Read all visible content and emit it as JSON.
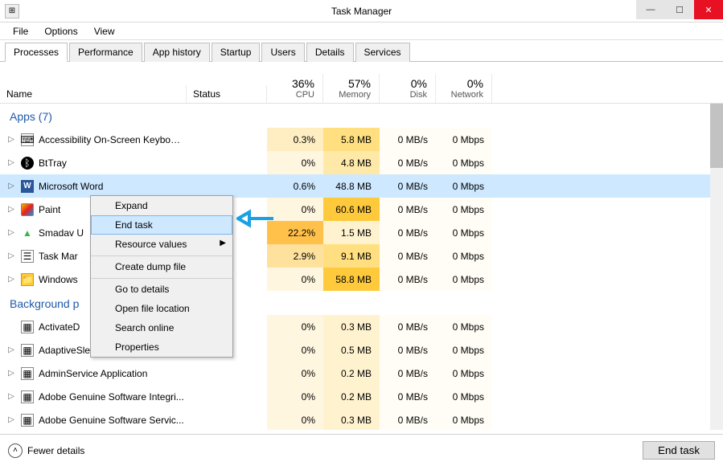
{
  "window": {
    "title": "Task Manager",
    "menus": [
      "File",
      "Options",
      "View"
    ],
    "tabs": [
      "Processes",
      "Performance",
      "App history",
      "Startup",
      "Users",
      "Details",
      "Services"
    ],
    "active_tab": 0
  },
  "columns": {
    "name": "Name",
    "status": "Status",
    "cpu": {
      "pct": "36%",
      "label": "CPU"
    },
    "memory": {
      "pct": "57%",
      "label": "Memory"
    },
    "disk": {
      "pct": "0%",
      "label": "Disk"
    },
    "network": {
      "pct": "0%",
      "label": "Network"
    }
  },
  "groups": {
    "apps_header": "Apps (7)",
    "background_header": "Background p"
  },
  "apps": [
    {
      "name": "Accessibility On-Screen Keyboard",
      "cpu": "0.3%",
      "mem": "5.8 MB",
      "disk": "0 MB/s",
      "net": "0 Mbps"
    },
    {
      "name": "BtTray",
      "cpu": "0%",
      "mem": "4.8 MB",
      "disk": "0 MB/s",
      "net": "0 Mbps"
    },
    {
      "name": "Microsoft Word",
      "cpu": "0.6%",
      "mem": "48.8 MB",
      "disk": "0 MB/s",
      "net": "0 Mbps"
    },
    {
      "name": "Paint",
      "cpu": "0%",
      "mem": "60.6 MB",
      "disk": "0 MB/s",
      "net": "0 Mbps"
    },
    {
      "name": "Smadav U",
      "cpu": "22.2%",
      "mem": "1.5 MB",
      "disk": "0 MB/s",
      "net": "0 Mbps"
    },
    {
      "name": "Task Mar",
      "cpu": "2.9%",
      "mem": "9.1 MB",
      "disk": "0 MB/s",
      "net": "0 Mbps"
    },
    {
      "name": "Windows",
      "cpu": "0%",
      "mem": "58.8 MB",
      "disk": "0 MB/s",
      "net": "0 Mbps"
    }
  ],
  "background": [
    {
      "name": "ActivateD",
      "cpu": "0%",
      "mem": "0.3 MB",
      "disk": "0 MB/s",
      "net": "0 Mbps"
    },
    {
      "name": "AdaptiveSleepService",
      "cpu": "0%",
      "mem": "0.5 MB",
      "disk": "0 MB/s",
      "net": "0 Mbps"
    },
    {
      "name": "AdminService Application",
      "cpu": "0%",
      "mem": "0.2 MB",
      "disk": "0 MB/s",
      "net": "0 Mbps"
    },
    {
      "name": "Adobe Genuine Software Integri...",
      "cpu": "0%",
      "mem": "0.2 MB",
      "disk": "0 MB/s",
      "net": "0 Mbps"
    },
    {
      "name": "Adobe Genuine Software Servic...",
      "cpu": "0%",
      "mem": "0.3 MB",
      "disk": "0 MB/s",
      "net": "0 Mbps"
    }
  ],
  "context_menu": {
    "items": [
      {
        "label": "Expand"
      },
      {
        "label": "End task",
        "highlight": true
      },
      {
        "label": "Resource values",
        "submenu": true
      },
      {
        "label": "Create dump file",
        "sep": true
      },
      {
        "label": "Go to details",
        "sep": true
      },
      {
        "label": "Open file location"
      },
      {
        "label": "Search online"
      },
      {
        "label": "Properties"
      }
    ]
  },
  "footer": {
    "fewer": "Fewer details",
    "end_task": "End task"
  }
}
